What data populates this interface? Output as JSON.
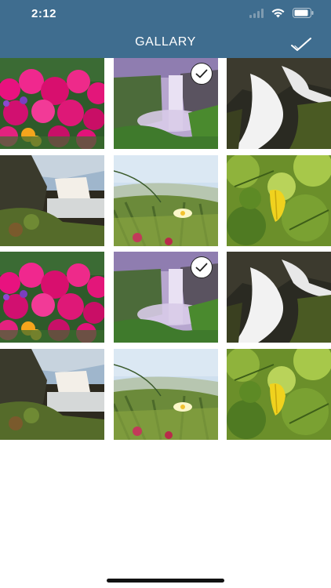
{
  "status_bar": {
    "time": "2:12"
  },
  "header": {
    "title": "GALLARY"
  },
  "colors": {
    "header_bg": "#3f6d8f",
    "badge_bg": "#ffffff"
  },
  "photos": [
    {
      "name": "flowers-photo",
      "scene": "flowers",
      "selected": false
    },
    {
      "name": "waterfall-photo",
      "scene": "waterfall",
      "selected": true
    },
    {
      "name": "cascade-photo",
      "scene": "cascade",
      "selected": false
    },
    {
      "name": "coast-photo",
      "scene": "coast",
      "selected": false
    },
    {
      "name": "dune-flower-photo",
      "scene": "dune",
      "selected": false
    },
    {
      "name": "leaves-photo",
      "scene": "leaves",
      "selected": false
    },
    {
      "name": "flowers-photo",
      "scene": "flowers",
      "selected": false
    },
    {
      "name": "waterfall-photo",
      "scene": "waterfall",
      "selected": true
    },
    {
      "name": "cascade-photo",
      "scene": "cascade",
      "selected": false
    },
    {
      "name": "coast-photo",
      "scene": "coast",
      "selected": false
    },
    {
      "name": "dune-flower-photo",
      "scene": "dune",
      "selected": false
    },
    {
      "name": "leaves-photo",
      "scene": "leaves",
      "selected": false
    }
  ]
}
